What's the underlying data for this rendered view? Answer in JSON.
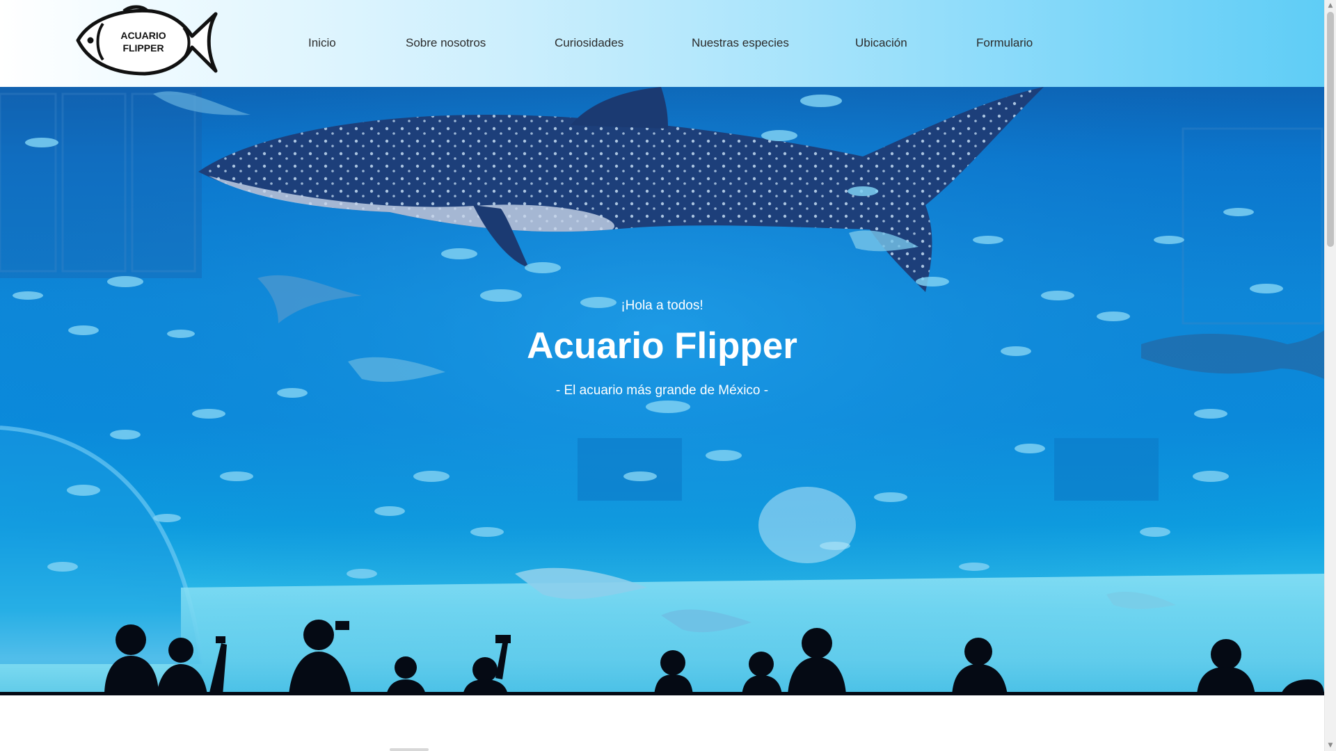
{
  "brand": {
    "logo_text_line1": "ACUARIO",
    "logo_text_line2": "FLIPPER"
  },
  "nav": {
    "items": [
      {
        "label": "Inicio"
      },
      {
        "label": "Sobre nosotros"
      },
      {
        "label": "Curiosidades"
      },
      {
        "label": "Nuestras especies"
      },
      {
        "label": "Ubicación"
      },
      {
        "label": "Formulario"
      }
    ]
  },
  "hero": {
    "greeting": "¡Hola a todos!",
    "title": "Acuario Flipper",
    "subtitle": "- El acuario más grande de México -"
  },
  "colors": {
    "header_gradient_start": "#ffffff",
    "header_gradient_end": "#5fcdf6",
    "hero_water": "#0a8bdc",
    "hero_text": "#ffffff",
    "nav_text": "#2b2b2b"
  },
  "icons": {
    "logo": "fish-logo-icon",
    "scroll_up": "chevron-up-icon",
    "scroll_down": "chevron-down-icon"
  }
}
